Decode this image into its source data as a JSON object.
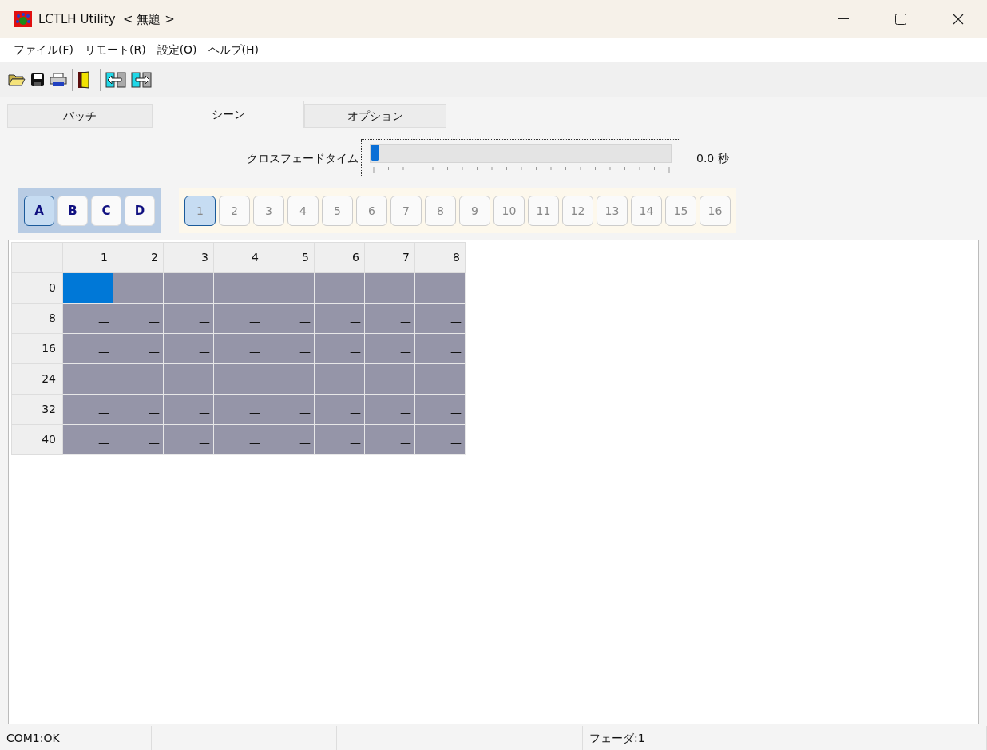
{
  "window": {
    "title": "LCTLH Utility  < 無題 >"
  },
  "menu": [
    "ファイル(F)",
    "リモート(R)",
    "設定(O)",
    "ヘルプ(H)"
  ],
  "tabs": [
    {
      "label": "パッチ",
      "selected": false
    },
    {
      "label": "シーン",
      "selected": true
    },
    {
      "label": "オプション",
      "selected": false
    }
  ],
  "crossfade": {
    "label": "クロスフェードタイム",
    "level": 0,
    "reading": "0.0 秒"
  },
  "banks": [
    {
      "label": "A",
      "selected": true
    },
    {
      "label": "B",
      "selected": false
    },
    {
      "label": "C",
      "selected": false
    },
    {
      "label": "D",
      "selected": false
    }
  ],
  "scenes": [
    {
      "label": "1",
      "selected": true
    },
    {
      "label": "2",
      "selected": false
    },
    {
      "label": "3",
      "selected": false
    },
    {
      "label": "4",
      "selected": false
    },
    {
      "label": "5",
      "selected": false
    },
    {
      "label": "6",
      "selected": false
    },
    {
      "label": "7",
      "selected": false
    },
    {
      "label": "8",
      "selected": false
    },
    {
      "label": "9",
      "selected": false
    },
    {
      "label": "10",
      "selected": false
    },
    {
      "label": "11",
      "selected": false
    },
    {
      "label": "12",
      "selected": false
    },
    {
      "label": "13",
      "selected": false
    },
    {
      "label": "14",
      "selected": false
    },
    {
      "label": "15",
      "selected": false
    },
    {
      "label": "16",
      "selected": false
    }
  ],
  "table": {
    "columns": [
      "1",
      "2",
      "3",
      "4",
      "5",
      "6",
      "7",
      "8"
    ],
    "rows": [
      {
        "header": "0",
        "cells": [
          {
            "text": "—",
            "selected": true
          },
          {
            "text": "—",
            "selected": false
          },
          {
            "text": "—",
            "selected": false
          },
          {
            "text": "—",
            "selected": false
          },
          {
            "text": "—",
            "selected": false
          },
          {
            "text": "—",
            "selected": false
          },
          {
            "text": "—",
            "selected": false
          },
          {
            "text": "—",
            "selected": false
          }
        ]
      },
      {
        "header": "8",
        "cells": [
          {
            "text": "—",
            "selected": false
          },
          {
            "text": "—",
            "selected": false
          },
          {
            "text": "—",
            "selected": false
          },
          {
            "text": "—",
            "selected": false
          },
          {
            "text": "—",
            "selected": false
          },
          {
            "text": "—",
            "selected": false
          },
          {
            "text": "—",
            "selected": false
          },
          {
            "text": "—",
            "selected": false
          }
        ]
      },
      {
        "header": "16",
        "cells": [
          {
            "text": "—",
            "selected": false
          },
          {
            "text": "—",
            "selected": false
          },
          {
            "text": "—",
            "selected": false
          },
          {
            "text": "—",
            "selected": false
          },
          {
            "text": "—",
            "selected": false
          },
          {
            "text": "—",
            "selected": false
          },
          {
            "text": "—",
            "selected": false
          },
          {
            "text": "—",
            "selected": false
          }
        ]
      },
      {
        "header": "24",
        "cells": [
          {
            "text": "—",
            "selected": false
          },
          {
            "text": "—",
            "selected": false
          },
          {
            "text": "—",
            "selected": false
          },
          {
            "text": "—",
            "selected": false
          },
          {
            "text": "—",
            "selected": false
          },
          {
            "text": "—",
            "selected": false
          },
          {
            "text": "—",
            "selected": false
          },
          {
            "text": "—",
            "selected": false
          }
        ]
      },
      {
        "header": "32",
        "cells": [
          {
            "text": "—",
            "selected": false
          },
          {
            "text": "—",
            "selected": false
          },
          {
            "text": "—",
            "selected": false
          },
          {
            "text": "—",
            "selected": false
          },
          {
            "text": "—",
            "selected": false
          },
          {
            "text": "—",
            "selected": false
          },
          {
            "text": "—",
            "selected": false
          },
          {
            "text": "—",
            "selected": false
          }
        ]
      },
      {
        "header": "40",
        "cells": [
          {
            "text": "—",
            "selected": false
          },
          {
            "text": "—",
            "selected": false
          },
          {
            "text": "—",
            "selected": false
          },
          {
            "text": "—",
            "selected": false
          },
          {
            "text": "—",
            "selected": false
          },
          {
            "text": "—",
            "selected": false
          },
          {
            "text": "—",
            "selected": false
          },
          {
            "text": "—",
            "selected": false
          }
        ]
      }
    ]
  },
  "status_bar": [
    "COM1:OK",
    "フェーダ:1"
  ]
}
